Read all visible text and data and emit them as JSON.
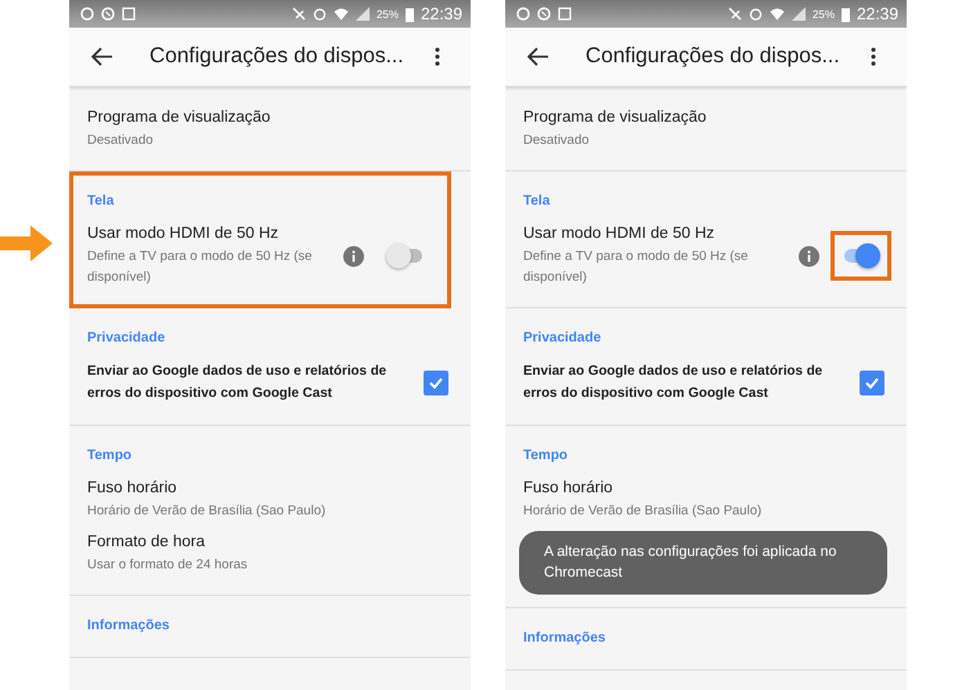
{
  "screens": [
    {
      "status_bar": {
        "battery": "25%",
        "time": "22:39"
      },
      "toolbar": {
        "title": "Configurações do dispos..."
      },
      "sections": [
        {
          "highlighted": false,
          "items": [
            {
              "kind": "text",
              "title": "Programa de visualização",
              "subtitle": "Desativado"
            }
          ]
        },
        {
          "header": "Tela",
          "highlighted": true,
          "items": [
            {
              "kind": "toggle",
              "title": "Usar modo HDMI de 50 Hz",
              "subtitle": "Define a TV para o modo de 50 Hz (se disponível)",
              "on": false,
              "highlighted": false
            }
          ]
        },
        {
          "header": "Privacidade",
          "highlighted": false,
          "items": [
            {
              "kind": "checkbox",
              "title": "Enviar ao Google dados de uso e relatórios de erros do dispositivo com Google Cast",
              "checked": true
            }
          ]
        },
        {
          "header": "Tempo",
          "highlighted": false,
          "items": [
            {
              "kind": "text",
              "title": "Fuso horário",
              "subtitle": "Horário de Verão de Brasília (Sao Paulo)"
            },
            {
              "kind": "text",
              "title": "Formato de hora",
              "subtitle": "Usar o formato de 24 horas"
            }
          ]
        },
        {
          "header": "Informações",
          "highlighted": false
        }
      ]
    },
    {
      "status_bar": {
        "battery": "25%",
        "time": "22:39"
      },
      "toolbar": {
        "title": "Configurações do dispos..."
      },
      "toast": "A alteração nas configurações foi aplicada no Chromecast",
      "sections": [
        {
          "highlighted": false,
          "items": [
            {
              "kind": "text",
              "title": "Programa de visualização",
              "subtitle": "Desativado"
            }
          ]
        },
        {
          "header": "Tela",
          "highlighted": false,
          "items": [
            {
              "kind": "toggle",
              "title": "Usar modo HDMI de 50 Hz",
              "subtitle": "Define a TV para o modo de 50 Hz (se disponível)",
              "on": true,
              "highlighted": true
            }
          ]
        },
        {
          "header": "Privacidade",
          "highlighted": false,
          "items": [
            {
              "kind": "checkbox",
              "title": "Enviar ao Google dados de uso e relatórios de erros do dispositivo com Google Cast",
              "checked": true
            }
          ]
        },
        {
          "header": "Tempo",
          "highlighted": false,
          "items": [
            {
              "kind": "text",
              "title": "Fuso horário",
              "subtitle": "Horário de Verão de Brasília (Sao Paulo)"
            }
          ]
        },
        {
          "header": "Informações",
          "highlighted": false
        }
      ]
    }
  ]
}
